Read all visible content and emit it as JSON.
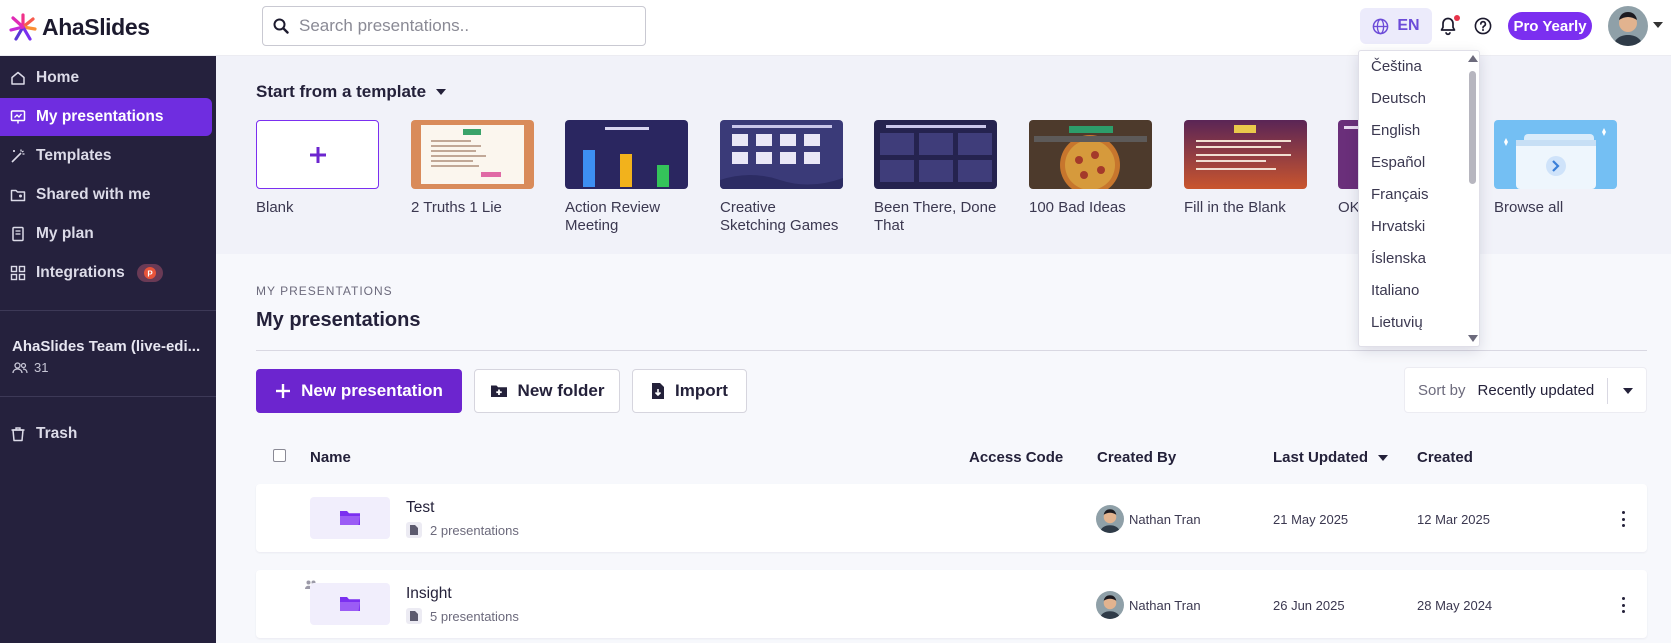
{
  "app": {
    "brand": "AhaSlides"
  },
  "header": {
    "search_placeholder": "Search presentations..",
    "language_code": "EN",
    "plan_badge": "Pro Yearly"
  },
  "sidebar": {
    "items": [
      {
        "label": "Home",
        "icon": "home-icon"
      },
      {
        "label": "My presentations",
        "icon": "presentation-icon",
        "active": true
      },
      {
        "label": "Templates",
        "icon": "magic-wand-icon"
      },
      {
        "label": "Shared with me",
        "icon": "shared-folder-icon"
      },
      {
        "label": "My plan",
        "icon": "plan-icon"
      },
      {
        "label": "Integrations",
        "icon": "integrations-icon"
      }
    ],
    "team": {
      "name": "AhaSlides Team (live-edi...",
      "members": "31"
    },
    "trash_label": "Trash"
  },
  "templates": {
    "title": "Start from a template",
    "items": [
      {
        "label": "Blank"
      },
      {
        "label": "2 Truths 1 Lie"
      },
      {
        "label": "Action Review Meeting"
      },
      {
        "label": "Creative Sketching Games"
      },
      {
        "label": "Been There, Done That"
      },
      {
        "label": "100 Bad Ideas"
      },
      {
        "label": "Fill in the Blank"
      },
      {
        "label": "OK"
      },
      {
        "label": "Browse all"
      }
    ]
  },
  "main": {
    "eyebrow": "MY PRESENTATIONS",
    "title": "My presentations",
    "new_presentation": "New presentation",
    "new_folder": "New folder",
    "import": "Import",
    "sort_label": "Sort by",
    "sort_value": "Recently updated"
  },
  "table": {
    "columns": {
      "name": "Name",
      "access_code": "Access Code",
      "created_by": "Created By",
      "last_updated": "Last Updated",
      "created": "Created"
    },
    "rows": [
      {
        "name": "Test",
        "count": "2 presentations",
        "created_by": "Nathan Tran",
        "last_updated": "21 May 2025",
        "created": "12 Mar 2025",
        "shared": false
      },
      {
        "name": "Insight",
        "count": "5 presentations",
        "created_by": "Nathan Tran",
        "last_updated": "26 Jun 2025",
        "created": "28 May 2024",
        "shared": true
      }
    ]
  },
  "language_menu": {
    "options": [
      "Čeština",
      "Deutsch",
      "English",
      "Español",
      "Français",
      "Hrvatski",
      "Íslenska",
      "Italiano",
      "Lietuvių"
    ]
  },
  "colors": {
    "brand_purple": "#7b2ff0",
    "sidebar_bg": "#25213d",
    "active_nav": "#6f2de0",
    "notification_dot": "#e8334a"
  }
}
